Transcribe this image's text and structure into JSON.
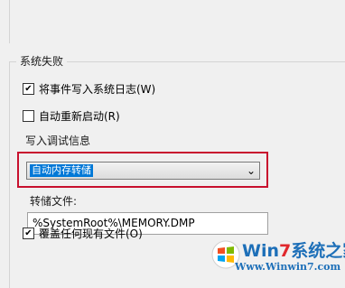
{
  "system_failure": {
    "group_title": "系统失败",
    "write_event_log": {
      "label": "将事件写入系统日志(W)",
      "checked": true
    },
    "auto_restart": {
      "label": "自动重新启动(R)",
      "checked": false
    }
  },
  "debug_info": {
    "section_label": "写入调试信息",
    "dump_type": {
      "selected": "自动内存转储",
      "arrow": "⌄"
    },
    "dump_file_label": "转储文件:",
    "dump_file_value": "%SystemRoot%\\MEMORY.DMP",
    "overwrite": {
      "label": "覆盖任何现有文件(O)",
      "checked": true
    }
  },
  "watermark": {
    "brand_prefix": "Win",
    "brand_seven": "7",
    "brand_suffix": "系统之家",
    "url": "Www.Winwin7.com"
  }
}
